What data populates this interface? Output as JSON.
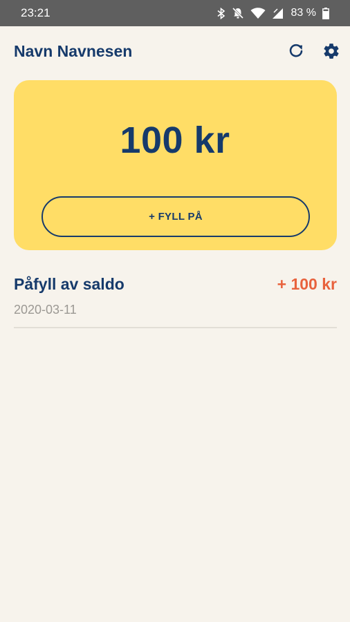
{
  "status_bar": {
    "time": "23:21",
    "battery": "83 %",
    "icons": [
      "bluetooth-icon",
      "mute-icon",
      "wifi-icon",
      "signal-icon",
      "battery-icon"
    ]
  },
  "header": {
    "user_name": "Navn Navnesen",
    "refresh_icon": "refresh-icon",
    "settings_icon": "gear-icon"
  },
  "balance": {
    "amount": "100 kr",
    "topup_label": "+ FYLL PÅ"
  },
  "transactions": [
    {
      "title": "Påfyll av saldo",
      "amount": "+ 100 kr",
      "date": "2020-03-11"
    }
  ],
  "colors": {
    "primary": "#163a6b",
    "accent": "#ffdd66",
    "positive_amount": "#e8623d",
    "background": "#f7f3ec"
  }
}
